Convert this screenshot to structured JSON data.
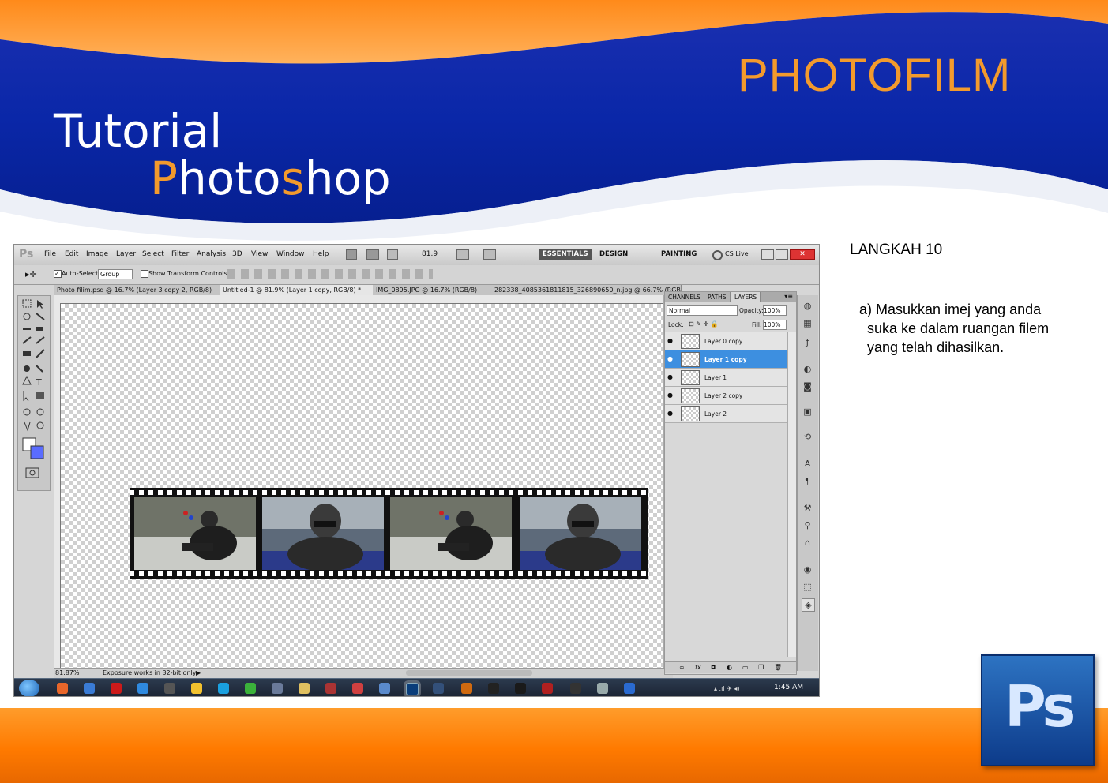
{
  "slide": {
    "brand_title": "PHOTOFILM",
    "tutorial_line1": "Tutorial",
    "tutorial_line2_a": "P",
    "tutorial_line2_b": "hoto",
    "tutorial_line2_c": "s",
    "tutorial_line2_d": "hop",
    "step_label": "LANGKAH 10",
    "instruction_line1": "a) Masukkan imej yang anda",
    "instruction_line2": "suka ke dalam ruangan filem",
    "instruction_line3": "yang telah dihasilkan.",
    "logo_text": "Ps",
    "colors": {
      "orange": "#f39a2c",
      "blue": "#0a2fa0",
      "white": "#ffffff"
    }
  },
  "photoshop": {
    "app_logo": "Ps",
    "menu": [
      "File",
      "Edit",
      "Image",
      "Layer",
      "Select",
      "Filter",
      "Analysis",
      "3D",
      "View",
      "Window",
      "Help"
    ],
    "zoom_value": "81.9",
    "workspaces": [
      "ESSENTIALS",
      "DESIGN",
      "PAINTING"
    ],
    "cs_live": "CS Live",
    "options": {
      "auto_select_label": "Auto-Select:",
      "auto_select_value": "Group",
      "transform_label": "Show Transform Controls"
    },
    "doc_tabs": [
      "Photo filim.psd @ 16.7% (Layer 3 copy 2, RGB/8)",
      "Untitled-1 @ 81.9% (Layer 1 copy, RGB/8) *",
      "IMG_0895.JPG @ 16.7% (RGB/8)",
      "282338_4085361811815_326890650_n.jpg @ 66.7% (RGB/8)"
    ],
    "status_zoom": "81.87%",
    "status_text": "Exposure works in 32-bit only",
    "layers_panel": {
      "tabs": [
        "CHANNELS",
        "PATHS",
        "LAYERS"
      ],
      "blend_mode": "Normal",
      "opacity_label": "Opacity:",
      "opacity_value": "100%",
      "lock_label": "Lock:",
      "fill_label": "Fill:",
      "fill_value": "100%",
      "layers": [
        {
          "name": "Layer 0 copy",
          "selected": false
        },
        {
          "name": "Layer 1 copy",
          "selected": true
        },
        {
          "name": "Layer 1",
          "selected": false
        },
        {
          "name": "Layer 2 copy",
          "selected": false
        },
        {
          "name": "Layer 2",
          "selected": false
        }
      ],
      "footer_icons": [
        "link-icon",
        "fx-icon",
        "mask-icon",
        "adjustment-icon",
        "group-icon",
        "new-layer-icon",
        "trash-icon"
      ]
    },
    "taskbar": {
      "time": "1:45 AM"
    }
  }
}
